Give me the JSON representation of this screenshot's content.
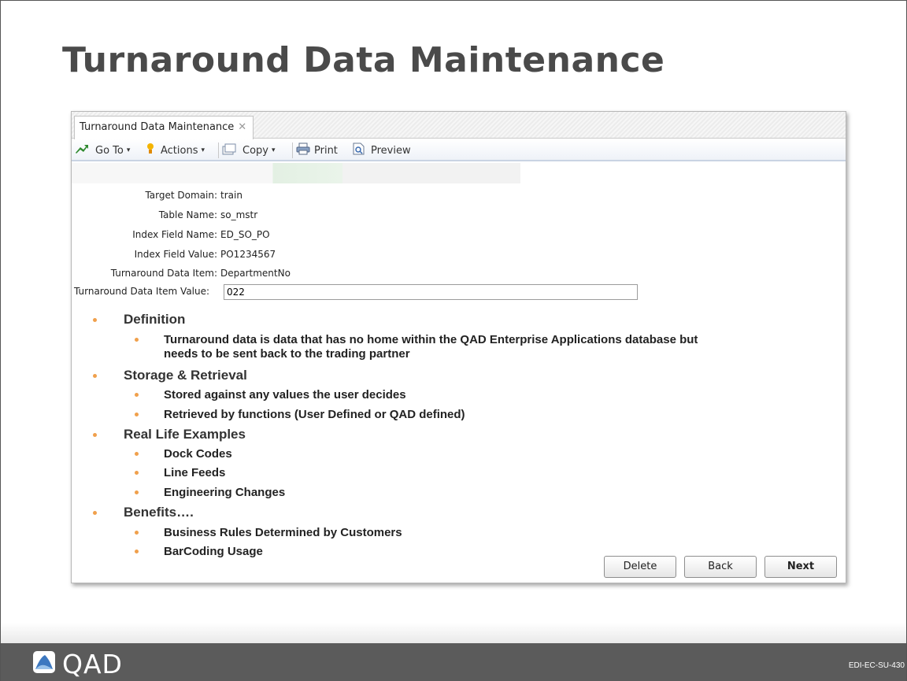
{
  "slide": {
    "title": "Turnaround Data Maintenance",
    "footer_code": "EDI-EC-SU-430",
    "logo_text": "QAD"
  },
  "window": {
    "tab_label": "Turnaround Data Maintenance",
    "tab_close_glyph": "✕",
    "toolbar": {
      "goto_label": "Go To",
      "actions_label": "Actions",
      "copy_label": "Copy",
      "print_label": "Print",
      "preview_label": "Preview",
      "caret": "▾"
    },
    "form": {
      "target_domain_label": "Target Domain:",
      "target_domain_value": "train",
      "table_name_label": "Table Name:",
      "table_name_value": "so_mstr",
      "index_field_name_label": "Index Field Name:",
      "index_field_name_value": "ED_SO_PO",
      "index_field_value_label": "Index Field Value:",
      "index_field_value_value": "PO1234567",
      "data_item_label": "Turnaround Data Item:",
      "data_item_value": "DepartmentNo",
      "data_item_value_label": "Turnaround Data Item Value:",
      "data_item_value_value": "022"
    },
    "buttons": {
      "delete": "Delete",
      "back": "Back",
      "next": "Next"
    }
  },
  "bullets": {
    "definition": {
      "heading": "Definition",
      "items": [
        "Turnaround data is data that has no home within the QAD Enterprise Applications database  but",
        "needs to be sent back to the trading partner"
      ]
    },
    "storage": {
      "heading": "Storage & Retrieval",
      "items": [
        "Stored against any values the user decides",
        "Retrieved by functions (User Defined or QAD defined)"
      ]
    },
    "examples": {
      "heading": "Real Life Examples",
      "items": [
        "Dock Codes",
        "Line Feeds",
        "Engineering Changes"
      ]
    },
    "benefits": {
      "heading": "Benefits….",
      "items": [
        "Business Rules Determined by Customers",
        "BarCoding Usage"
      ]
    }
  },
  "colors": {
    "bullet": "#f0a04c",
    "footer": "#5b5b5b",
    "title": "#4a4a4a"
  }
}
